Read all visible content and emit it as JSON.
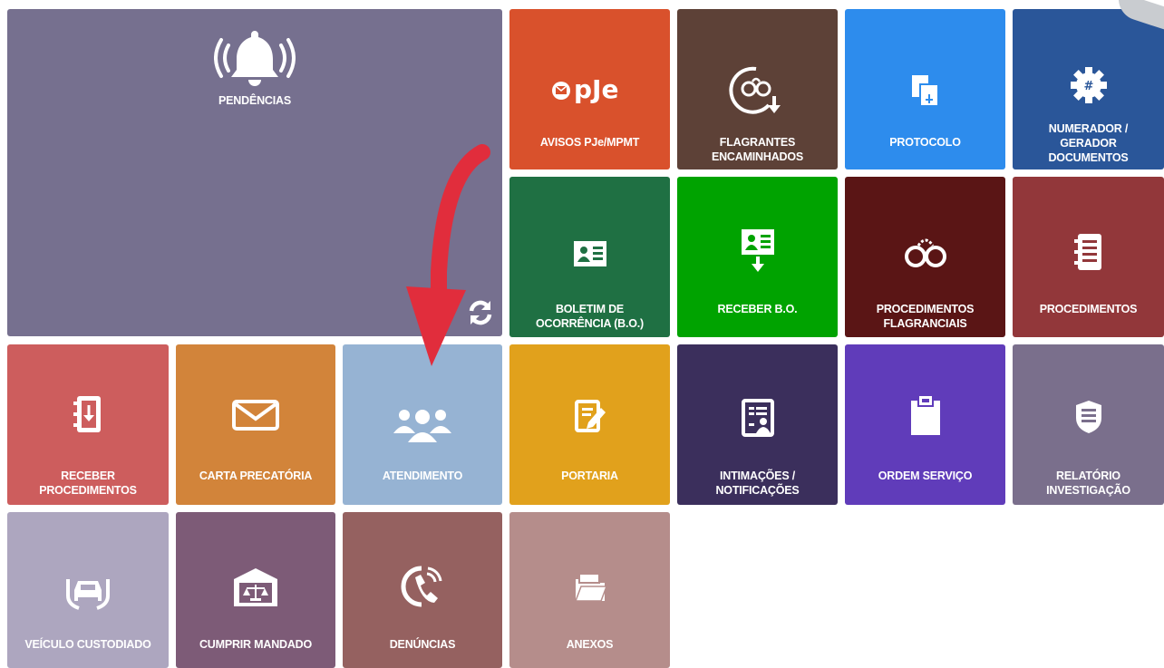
{
  "tiles": {
    "pendencias": {
      "label": "PENDÊNCIAS",
      "icon": "bell-ringing-icon",
      "color": "#76708f"
    },
    "avisos": {
      "label": "AVISOS PJe/MPMT",
      "logo_text": "pJe",
      "icon": "pje-logo",
      "color": "#d9512c"
    },
    "flagrantes": {
      "label": "FLAGRANTES\nENCAMINHADOS",
      "icon": "handcuffs-forward-icon",
      "color": "#5d4137"
    },
    "protocolo": {
      "label": "PROTOCOLO",
      "icon": "documents-icon",
      "color": "#2d8ced"
    },
    "numerador": {
      "label": "NUMERADOR /\nGERADOR\nDOCUMENTOS",
      "icon": "gear-hash-icon",
      "color": "#2a5699"
    },
    "boletim": {
      "label": "BOLETIM DE\nOCORRÊNCIA (B.O.)",
      "icon": "id-card-icon",
      "color": "#1f7043"
    },
    "receber_bo": {
      "label": "RECEBER B.O.",
      "icon": "id-card-download-icon",
      "color": "#00a300"
    },
    "proc_flag": {
      "label": "PROCEDIMENTOS\nFLAGRANCIAIS",
      "icon": "handcuffs-icon",
      "color": "#5a1515"
    },
    "procedimentos": {
      "label": "PROCEDIMENTOS",
      "icon": "notebook-icon",
      "color": "#92373a"
    },
    "receber_proc": {
      "label": "RECEBER\nPROCEDIMENTOS",
      "icon": "notebook-download-icon",
      "color": "#cd5d5d"
    },
    "carta": {
      "label": "CARTA PRECATÓRIA",
      "icon": "envelope-icon",
      "color": "#d2843a"
    },
    "atendimento": {
      "label": "ATENDIMENTO",
      "icon": "group-people-icon",
      "color": "#96b3d3"
    },
    "portaria": {
      "label": "PORTARIA",
      "icon": "document-edit-icon",
      "color": "#e1a11c"
    },
    "intimacoes": {
      "label": "INTIMAÇÕES /\nNOTIFICAÇÕES",
      "icon": "document-person-icon",
      "color": "#3b2f5c"
    },
    "ordem": {
      "label": "ORDEM SERVIÇO",
      "icon": "clipboard-icon",
      "color": "#603cba"
    },
    "relatorio": {
      "label": "RELATÓRIO\nINVESTIGAÇÃO",
      "icon": "shield-list-icon",
      "color": "#7a6f8c"
    },
    "veiculo": {
      "label": "VEÍCULO CUSTODIADO",
      "icon": "car-hands-icon",
      "color": "#ada6bf"
    },
    "cumprir": {
      "label": "CUMPRIR MANDADO",
      "icon": "courthouse-scales-icon",
      "color": "#7d5b77"
    },
    "denuncias": {
      "label": "DENÚNCIAS",
      "icon": "phone-ringing-icon",
      "color": "#956160"
    },
    "anexos": {
      "label": "ANEXOS",
      "icon": "folder-open-icon",
      "color": "#b58d8b"
    }
  },
  "refresh_icon": "refresh-icon",
  "arrow_color": "#e12d3c"
}
